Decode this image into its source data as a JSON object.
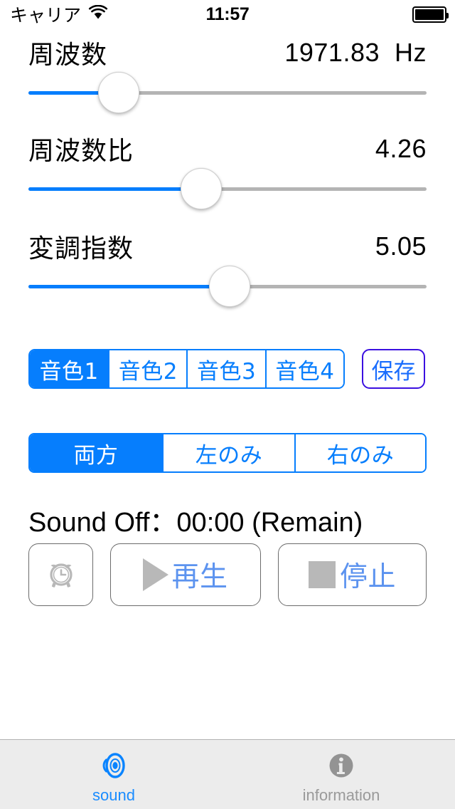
{
  "status_bar": {
    "carrier": "キャリア",
    "wifi_icon": "wifi-icon",
    "time": "11:57",
    "battery_icon": "battery-full-icon"
  },
  "sliders": [
    {
      "name": "frequency",
      "label": "周波数",
      "value": "1971.83  Hz",
      "fill_percent": 22.7
    },
    {
      "name": "frequency-ratio",
      "label": "周波数比",
      "value": "4.26",
      "fill_percent": 43.4
    },
    {
      "name": "modulation-index",
      "label": "変調指数",
      "value": "5.05",
      "fill_percent": 50.5
    }
  ],
  "tone_segmented": {
    "options": [
      "音色1",
      "音色2",
      "音色3",
      "音色4"
    ],
    "selected_index": 0
  },
  "save_button": {
    "label": "保存",
    "border_color": "#3b10e0",
    "text_color": "#1a6dfd"
  },
  "channel_segmented": {
    "options": [
      "両方",
      "左のみ",
      "右のみ"
    ],
    "selected_index": 0
  },
  "sound_off": {
    "text": "Sound Off：00:00 (Remain)"
  },
  "transport": {
    "timer_button": {
      "icon": "alarm-clock-icon",
      "label": ""
    },
    "play_button": {
      "icon": "play-triangle-icon",
      "label": "再生"
    },
    "stop_button": {
      "icon": "stop-square-icon",
      "label": "停止"
    }
  },
  "tab_bar": {
    "tabs": [
      {
        "label": "sound",
        "icon": "speaker-sound-icon",
        "active": true,
        "color": "#1a8cff"
      },
      {
        "label": "information",
        "icon": "info-circle-icon",
        "active": false,
        "color": "#9a9a9a"
      }
    ]
  },
  "theme": {
    "accent": "#067efd",
    "track_inactive": "#b4b4b4",
    "disabled_gray": "#b8b8b8",
    "tab_bar_bg": "#ececec"
  }
}
